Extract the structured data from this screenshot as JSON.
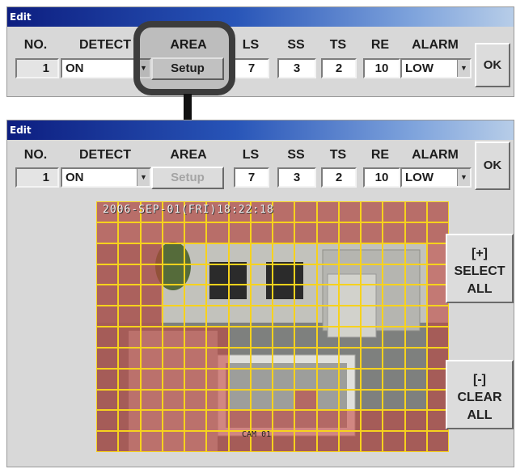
{
  "window_title": "Edit",
  "columns": [
    "NO.",
    "DETECT",
    "AREA",
    "LS",
    "SS",
    "TS",
    "RE",
    "ALARM"
  ],
  "row": {
    "no": "1",
    "detect": "ON",
    "area_button": "Setup",
    "ls": "7",
    "ss": "3",
    "ts": "2",
    "re": "10",
    "alarm": "LOW"
  },
  "ok_label": "OK",
  "select_all": {
    "line1": "[+]",
    "line2": "SELECT",
    "line3": "ALL"
  },
  "clear_all": {
    "line1": "[-]",
    "line2": "CLEAR",
    "line3": "ALL"
  },
  "camera": {
    "osd_text": "2006-SEP-01(FRI)18:22:18",
    "cam_label": "CAM 01",
    "grid_cols": 16,
    "grid_rows": 12,
    "active_color": "#c43e38",
    "grid_line_color": "#f6d21d"
  },
  "colors": {
    "title_bar_start": "#0d1e80",
    "title_bar_end": "#b7cde8",
    "panel_bg": "#d8d8d8"
  }
}
